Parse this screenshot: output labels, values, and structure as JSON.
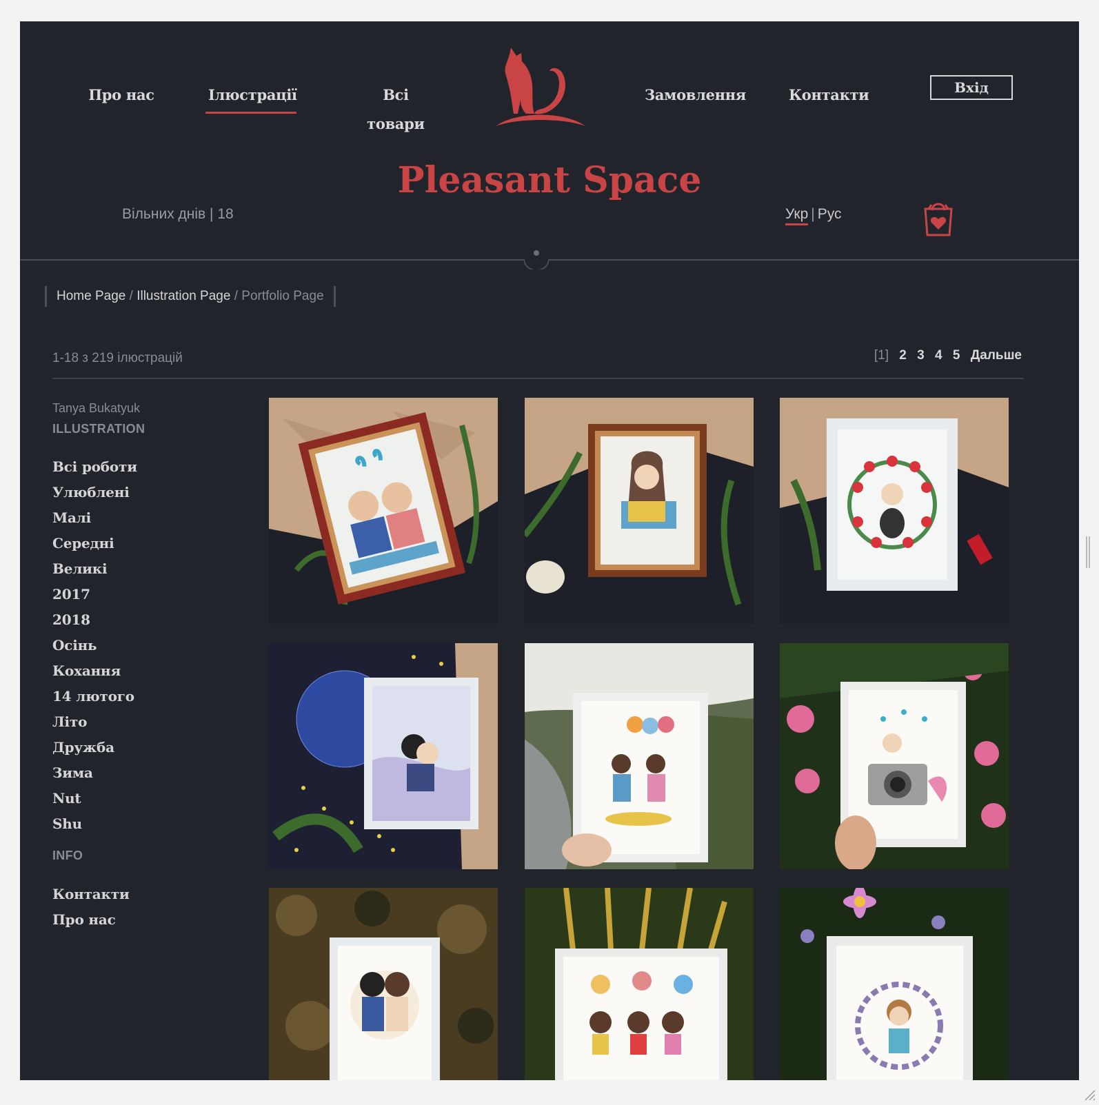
{
  "nav": {
    "left": [
      "Про нас",
      "Ілюстрації",
      "Всі товари"
    ],
    "right": [
      "Замовлення",
      "Контакти"
    ],
    "login": "Вхід"
  },
  "brand": "Pleasant Space",
  "free_days": "Вільних днів | 18",
  "lang": {
    "current": "Укр",
    "sep": "|",
    "alt": "Рус"
  },
  "breadcrumb": {
    "home": "Home Page",
    "sep": "/",
    "illustration": "Illustration Page",
    "current": "Portfolio Page"
  },
  "count": "1-18 з 219 ілюстрацій",
  "pager": {
    "current": "[1]",
    "pages": [
      "2",
      "3",
      "4",
      "5"
    ],
    "next": "Дальше"
  },
  "sidebar": {
    "author": "Tanya Bukatyuk",
    "section1": "ILLUSTRATION",
    "items": [
      "Всі роботи",
      "Улюблені",
      "Малі",
      "Середні",
      "Великі",
      "2017",
      "2018",
      "Осінь",
      "Кохання",
      "14 лютого",
      "Літо",
      "Дружба",
      "Зима",
      "Nut",
      "Shu"
    ],
    "section2": "INFO",
    "info_items": [
      "Контакти",
      "Про нас"
    ]
  },
  "colors": {
    "background": "#22242b",
    "accent": "#c94545",
    "text": "#d9d9d9",
    "muted": "#8a8c92"
  },
  "gallery": [
    {
      "name": "couple-banner-illustration"
    },
    {
      "name": "girl-with-books-illustration"
    },
    {
      "name": "girl-with-cat-tulips-illustration"
    },
    {
      "name": "stars-couple-illustration"
    },
    {
      "name": "balloons-couple-river-illustration"
    },
    {
      "name": "girl-camera-flowers-illustration"
    },
    {
      "name": "kissing-couple-forest-illustration"
    },
    {
      "name": "sisters-balloons-illustration"
    },
    {
      "name": "girl-floral-wreath-illustration"
    }
  ]
}
